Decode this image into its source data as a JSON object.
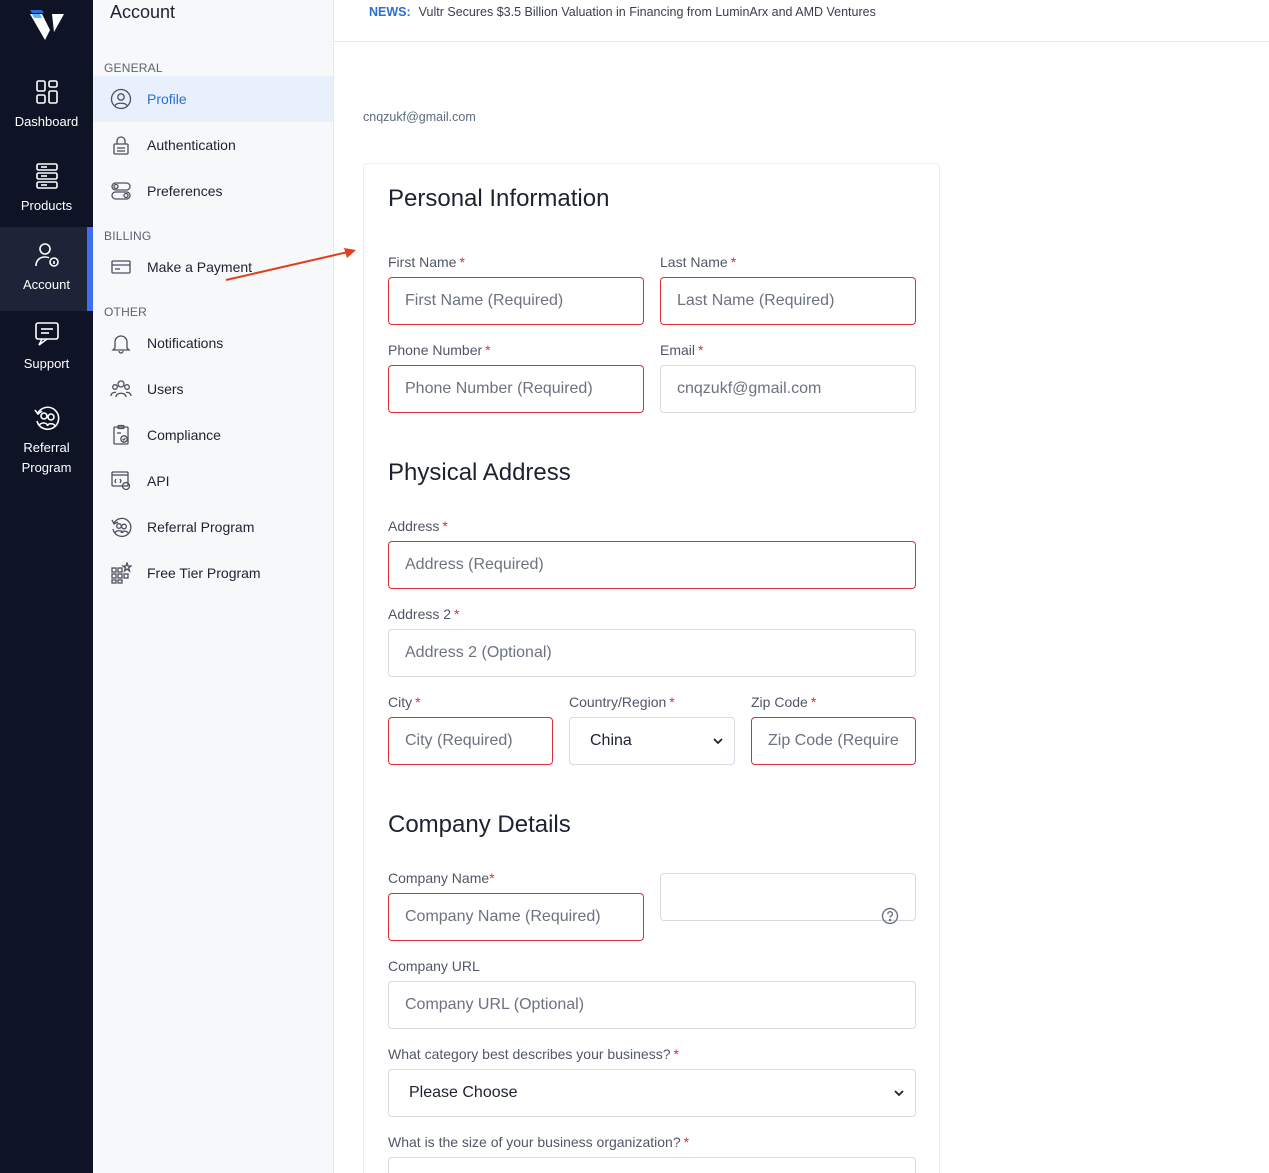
{
  "rail": {
    "items": [
      {
        "label": "Dashboard"
      },
      {
        "label": "Products"
      },
      {
        "label": "Account"
      },
      {
        "label": "Support"
      },
      {
        "label": "Referral Program"
      }
    ]
  },
  "sidebar": {
    "title": "Account",
    "sections": {
      "general": "GENERAL",
      "billing": "BILLING",
      "other": "OTHER"
    },
    "items": [
      {
        "label": "Profile",
        "icon": "user-circle-icon"
      },
      {
        "label": "Authentication",
        "icon": "lock-icon"
      },
      {
        "label": "Preferences",
        "icon": "toggle-icon"
      },
      {
        "label": "Make a Payment",
        "icon": "credit-card-icon"
      },
      {
        "label": "Notifications",
        "icon": "bell-icon"
      },
      {
        "label": "Users",
        "icon": "users-icon"
      },
      {
        "label": "Compliance",
        "icon": "clipboard-check-icon"
      },
      {
        "label": "API",
        "icon": "api-icon"
      },
      {
        "label": "Referral Program",
        "icon": "referral-icon"
      },
      {
        "label": "Free Tier Program",
        "icon": "grid-star-icon"
      }
    ]
  },
  "news": {
    "tag": "NEWS:",
    "text": "Vultr Secures $3.5 Billion Valuation in Financing from LuminArx and AMD Ventures"
  },
  "account_email": "cnqzukf@gmail.com",
  "form": {
    "personal_title": "Personal Information",
    "first_name": {
      "label": "First Name",
      "req": "*",
      "placeholder": "First Name (Required)"
    },
    "last_name": {
      "label": "Last Name",
      "req": "*",
      "placeholder": "Last Name (Required)"
    },
    "phone": {
      "label": "Phone Number",
      "req": "*",
      "placeholder": "Phone Number (Required)"
    },
    "email": {
      "label": "Email",
      "req": "*",
      "placeholder": "cnqzukf@gmail.com"
    },
    "address_title": "Physical Address",
    "address": {
      "label": "Address",
      "req": "*",
      "placeholder": "Address (Required)"
    },
    "address2": {
      "label": "Address 2",
      "req": "*",
      "placeholder": "Address 2 (Optional)"
    },
    "city": {
      "label": "City",
      "req": "*",
      "placeholder": "City (Required)"
    },
    "country": {
      "label": "Country/Region",
      "req": "*",
      "value": "China"
    },
    "zip": {
      "label": "Zip Code",
      "req": "*",
      "placeholder": "Zip Code (Require"
    },
    "company_title": "Company Details",
    "company_name": {
      "label": "Company Name",
      "req": "*",
      "placeholder": "Company Name (Required)"
    },
    "company_url": {
      "label": "Company URL",
      "placeholder": "Company URL (Optional)"
    },
    "category": {
      "label": "What category best describes your business?",
      "req": "*",
      "value": "Please Choose"
    },
    "size": {
      "label": "What is the size of your business organization?",
      "req": "*"
    }
  },
  "colors": {
    "rail_bg": "#0e1326",
    "accent": "#2a6fd6",
    "error": "#d9303a",
    "arrow": "#e0411c"
  }
}
